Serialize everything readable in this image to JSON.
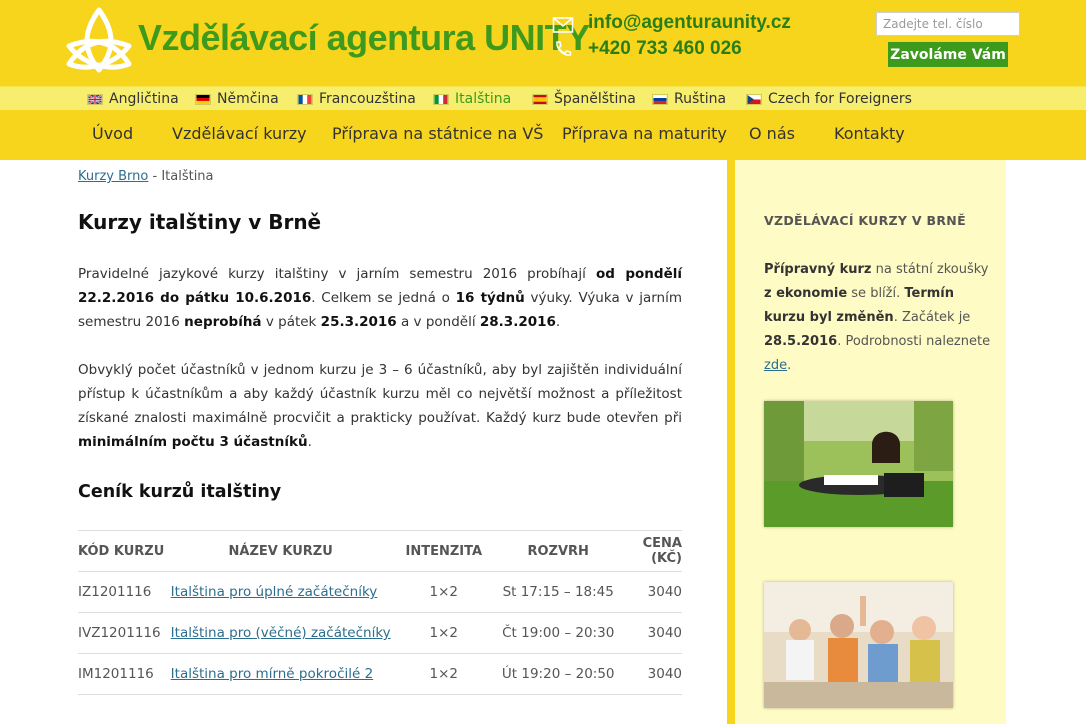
{
  "header": {
    "site_title": "Vzdělávací agentura UNITY",
    "email": "info@agenturaunity.cz",
    "phone": "+420 733 460 026",
    "phone_placeholder": "Zadejte tel. číslo",
    "call_button": "Zavoláme Vám",
    "brand_color": "#3d9a1d",
    "header_color": "#f7d51d"
  },
  "languages": [
    {
      "label": "Angličtina",
      "flag": "uk-flag-icon"
    },
    {
      "label": "Němčina",
      "flag": "germany-flag-icon"
    },
    {
      "label": "Francouzština",
      "flag": "france-flag-icon"
    },
    {
      "label": "Italština",
      "flag": "italy-flag-icon",
      "active": true
    },
    {
      "label": "Španělština",
      "flag": "spain-flag-icon"
    },
    {
      "label": "Ruština",
      "flag": "russia-flag-icon"
    },
    {
      "label": "Czech for Foreigners",
      "flag": "czech-flag-icon"
    }
  ],
  "nav": [
    {
      "label": "Úvod"
    },
    {
      "label": "Vzdělávací kurzy"
    },
    {
      "label": "Příprava na státnice na VŠ"
    },
    {
      "label": "Příprava na maturity"
    },
    {
      "label": "O nás"
    },
    {
      "label": "Kontakty"
    }
  ],
  "breadcrumb": {
    "link": "Kurzy Brno",
    "separator": " - ",
    "current": "Italština"
  },
  "content": {
    "title": "Kurzy italštiny v Brně",
    "p1": {
      "t1": "Pravidelné jazykové kurzy italštiny v jarním semestru 2016 probíhají ",
      "b1": "od pondělí 22.2.2016 do pátku 10.6.2016",
      "t2": ". Celkem se jedná o ",
      "b2": "16 týdnů",
      "t3": " výuky. Výuka v jarním semestru 2016 ",
      "b3": "neprobíhá",
      "t4": " v pátek ",
      "b4": "25.3.2016",
      "t5": " a v pondělí ",
      "b5": "28.3.2016",
      "t6": "."
    },
    "p2": {
      "t1": "Obvyklý počet účastníků v jednom kurzu je 3 – 6 účastníků, aby byl zajištěn individuální přístup k účastníkům a aby každý účastník kurzu měl co největší možnost a příležitost získané znalosti maximálně procvičit a prakticky používat. Každý kurz bude otevřen při ",
      "b1": "minimálním počtu 3 účastníků",
      "t2": "."
    },
    "price_title": "Ceník kurzů italštiny",
    "table": {
      "headers": [
        "KÓD KURZU",
        "NÁZEV KURZU",
        "INTENZITA",
        "ROZVRH",
        "CENA (KČ)"
      ],
      "rows": [
        {
          "code": "IZ1201116",
          "name": "Italština pro úplné začátečníky",
          "intensity": "1×2",
          "schedule": "St 17:15 – 18:45",
          "price": "3040"
        },
        {
          "code": "IVZ1201116",
          "name": "Italština pro (věčné) začátečníky",
          "intensity": "1×2",
          "schedule": "Čt 19:00 – 20:30",
          "price": "3040"
        },
        {
          "code": "IM1201116",
          "name": "Italština pro mírně pokročilé 2",
          "intensity": "1×2",
          "schedule": "Út 19:20 – 20:50",
          "price": "3040"
        }
      ]
    }
  },
  "sidebar": {
    "title": "VZDĚLÁVACÍ KURZY V BRNĚ",
    "b1": "Přípravný kurz",
    "t1": " na státní zkoušky ",
    "b2": "z ekonomie",
    "t2": " se blíží. ",
    "b3": "Termín kurzu byl změněn",
    "t3": ". Začátek je ",
    "b4": "28.5.2016",
    "t4": ". Podrobnosti naleznete ",
    "link": "zde",
    "t5": "."
  }
}
